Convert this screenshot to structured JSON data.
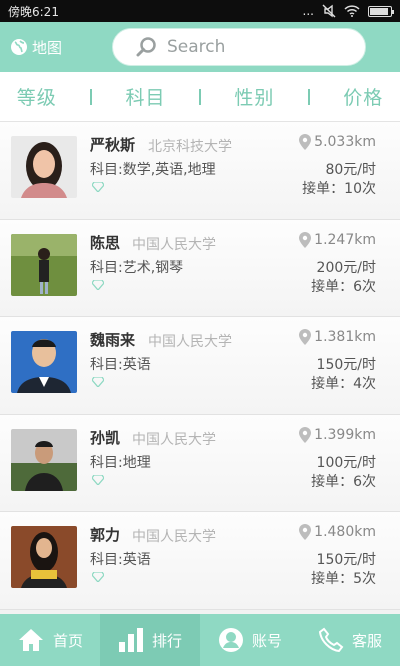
{
  "status": {
    "time": "傍晚6:21",
    "signal": "...",
    "icons": [
      "mute-icon",
      "wifi-icon",
      "battery-icon"
    ]
  },
  "topbar": {
    "map_label": "地图",
    "search_placeholder": "Search"
  },
  "filters": [
    "等级",
    "科目",
    "性别",
    "价格"
  ],
  "tutors": [
    {
      "name": "严秋斯",
      "school": "北京科技大学",
      "subject": "科目:数学,英语,地理",
      "distance": "5.033km",
      "price": "80元/时",
      "orders": "接单：10次"
    },
    {
      "name": "陈思",
      "school": "中国人民大学",
      "subject": "科目:艺术,钢琴",
      "distance": "1.247km",
      "price": "200元/时",
      "orders": "接单：6次"
    },
    {
      "name": "魏雨来",
      "school": "中国人民大学",
      "subject": "科目:英语",
      "distance": "1.381km",
      "price": "150元/时",
      "orders": "接单：4次"
    },
    {
      "name": "孙凯",
      "school": "中国人民大学",
      "subject": "科目:地理",
      "distance": "1.399km",
      "price": "100元/时",
      "orders": "接单：6次"
    },
    {
      "name": "郭力",
      "school": "中国人民大学",
      "subject": "科目:英语",
      "distance": "1.480km",
      "price": "150元/时",
      "orders": "接单：5次"
    }
  ],
  "tabbar": {
    "home": "首页",
    "rank": "排行",
    "account": "账号",
    "service": "客服"
  },
  "colors": {
    "accent": "#8fd9c3",
    "filter_text": "#7ccbb3",
    "tab_active": "#7dcbb4"
  }
}
